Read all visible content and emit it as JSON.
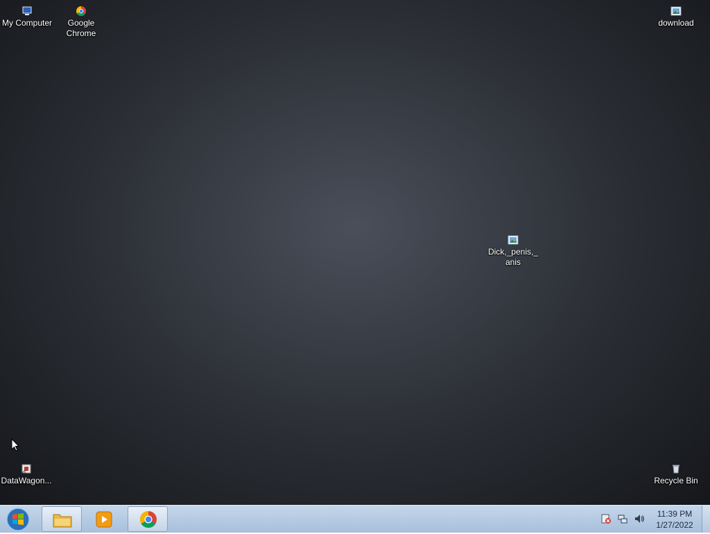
{
  "desktop": {
    "icons": [
      {
        "label": "My Computer",
        "icon": "computer-icon"
      },
      {
        "label": "Google Chrome",
        "icon": "chrome-icon"
      },
      {
        "label": "download",
        "icon": "image-file-icon"
      },
      {
        "label": "Dick,_penis,_anis",
        "icon": "image-file-icon"
      },
      {
        "label": "DataWagon...",
        "icon": "shortcut-icon"
      },
      {
        "label": "Recycle Bin",
        "icon": "recycle-bin-icon"
      }
    ]
  },
  "taskbar": {
    "start_icon": "windows-logo-icon",
    "pinned": [
      {
        "icon": "file-explorer-icon"
      },
      {
        "icon": "media-player-icon"
      },
      {
        "icon": "chrome-icon"
      }
    ],
    "tray": [
      {
        "icon": "action-center-icon"
      },
      {
        "icon": "network-icon"
      },
      {
        "icon": "volume-icon"
      }
    ],
    "clock": {
      "time": "11:39 PM",
      "date": "1/27/2022"
    }
  },
  "colors": {
    "taskbar": "#b8cce3",
    "chrome_red": "#db4437",
    "chrome_green": "#0f9d58",
    "chrome_yellow": "#f4b400",
    "chrome_blue": "#4285f4"
  }
}
